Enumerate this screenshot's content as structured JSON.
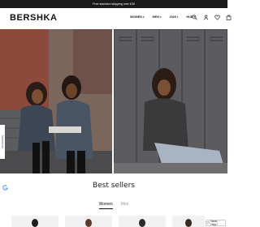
{
  "promo": {
    "text": "Free standard shipping over £30"
  },
  "header": {
    "logo": "BERSHKA",
    "nav": [
      {
        "label": "WOMEN"
      },
      {
        "label": "MEN"
      },
      {
        "label": "2026"
      },
      {
        "label": "HUB"
      }
    ]
  },
  "section": {
    "title": "Best sellers"
  },
  "tabs": [
    {
      "label": "Women",
      "active": true
    },
    {
      "label": "Men",
      "active": false
    }
  ],
  "chat": {
    "label": "Need Help?"
  },
  "side_badge": {
    "text": "Accessibility"
  }
}
